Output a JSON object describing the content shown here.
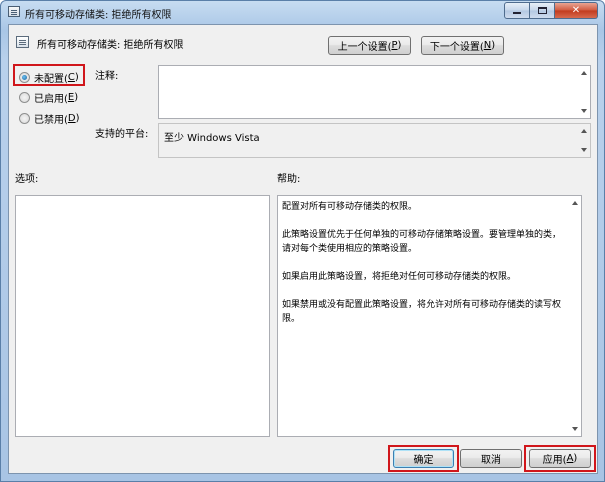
{
  "window": {
    "title": "所有可移动存储类: 拒绝所有权限",
    "minimize_icon": "minimize-icon",
    "maximize_icon": "maximize-icon",
    "close_glyph": "✕"
  },
  "header": {
    "policy_title": "所有可移动存储类: 拒绝所有权限",
    "prev_button": {
      "text": "上一个设置(",
      "key": "P",
      "end": ")"
    },
    "next_button": {
      "text": "下一个设置(",
      "key": "N",
      "end": ")"
    }
  },
  "state_options": [
    {
      "text": "未配置(",
      "key": "C",
      "end": ")",
      "checked": true
    },
    {
      "text": "已启用(",
      "key": "E",
      "end": ")",
      "checked": false
    },
    {
      "text": "已禁用(",
      "key": "D",
      "end": ")",
      "checked": false
    }
  ],
  "comment": {
    "label": "注释:",
    "value": ""
  },
  "platform": {
    "label": "支持的平台:",
    "value": "至少 Windows Vista"
  },
  "options": {
    "label": "选项:"
  },
  "help": {
    "label": "帮助:",
    "paragraphs": [
      "配置对所有可移动存储类的权限。",
      "此策略设置优先于任何单独的可移动存储策略设置。要管理单独的类，请对每个类使用相应的策略设置。",
      "如果启用此策略设置，将拒绝对任何可移动存储类的权限。",
      "如果禁用或没有配置此策略设置，将允许对所有可移动存储类的读写权限。"
    ]
  },
  "footer": {
    "ok_button": "确定",
    "cancel_button": "取消",
    "apply_button": {
      "text": "应用(",
      "key": "A",
      "end": ")"
    }
  },
  "highlight_color": "#d0161b"
}
